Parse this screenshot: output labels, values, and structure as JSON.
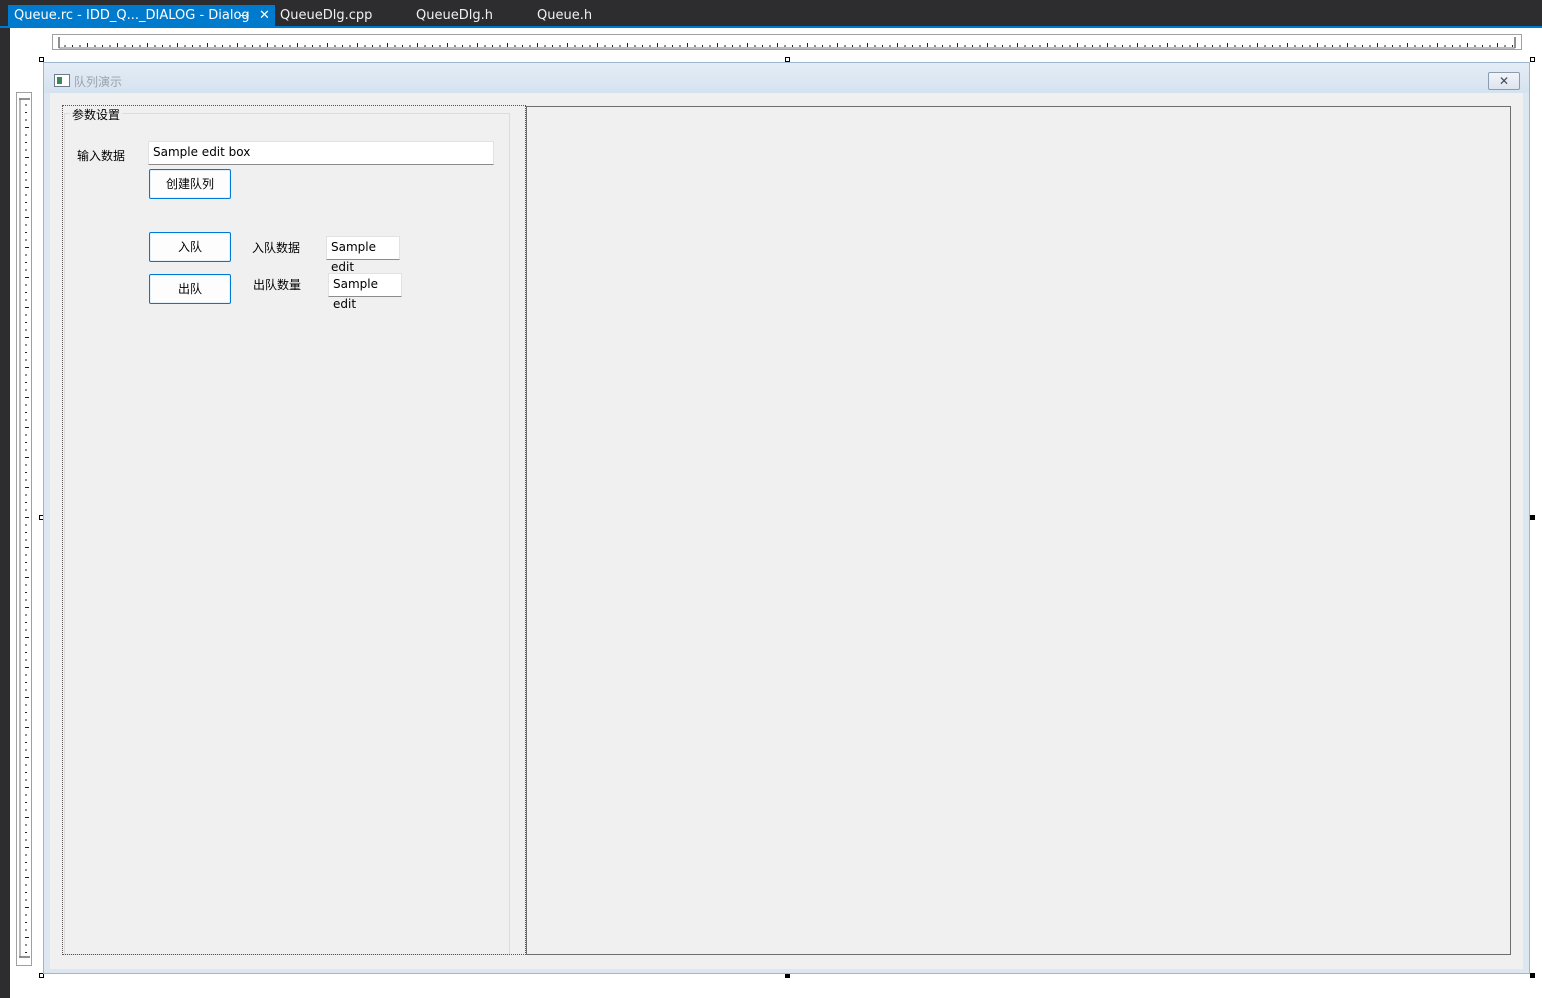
{
  "tabs": [
    {
      "label": "Queue.rc - IDD_Q..._DIALOG - Dialog",
      "active": true
    },
    {
      "label": "QueueDlg.cpp",
      "active": false
    },
    {
      "label": "QueueDlg.h",
      "active": false
    },
    {
      "label": "Queue.h",
      "active": false
    }
  ],
  "tab_icons": {
    "pin": "⊸",
    "close": "✕"
  },
  "dialog": {
    "title": "队列演示",
    "close_glyph": "✕",
    "group": {
      "label": "参数设置",
      "input_label": "输入数据",
      "input_value": "Sample edit box",
      "create_button": "创建队列",
      "enqueue_button": "入队",
      "enqueue_label": "入队数据",
      "enqueue_value": "Sample edit",
      "dequeue_button": "出队",
      "dequeue_label": "出队数量",
      "dequeue_value": "Sample edit"
    }
  },
  "colors": {
    "tab_active": "#007acc",
    "tab_bar": "#2d2d30",
    "button_border": "#0078d7",
    "dialog_client": "#f0f0f0"
  }
}
